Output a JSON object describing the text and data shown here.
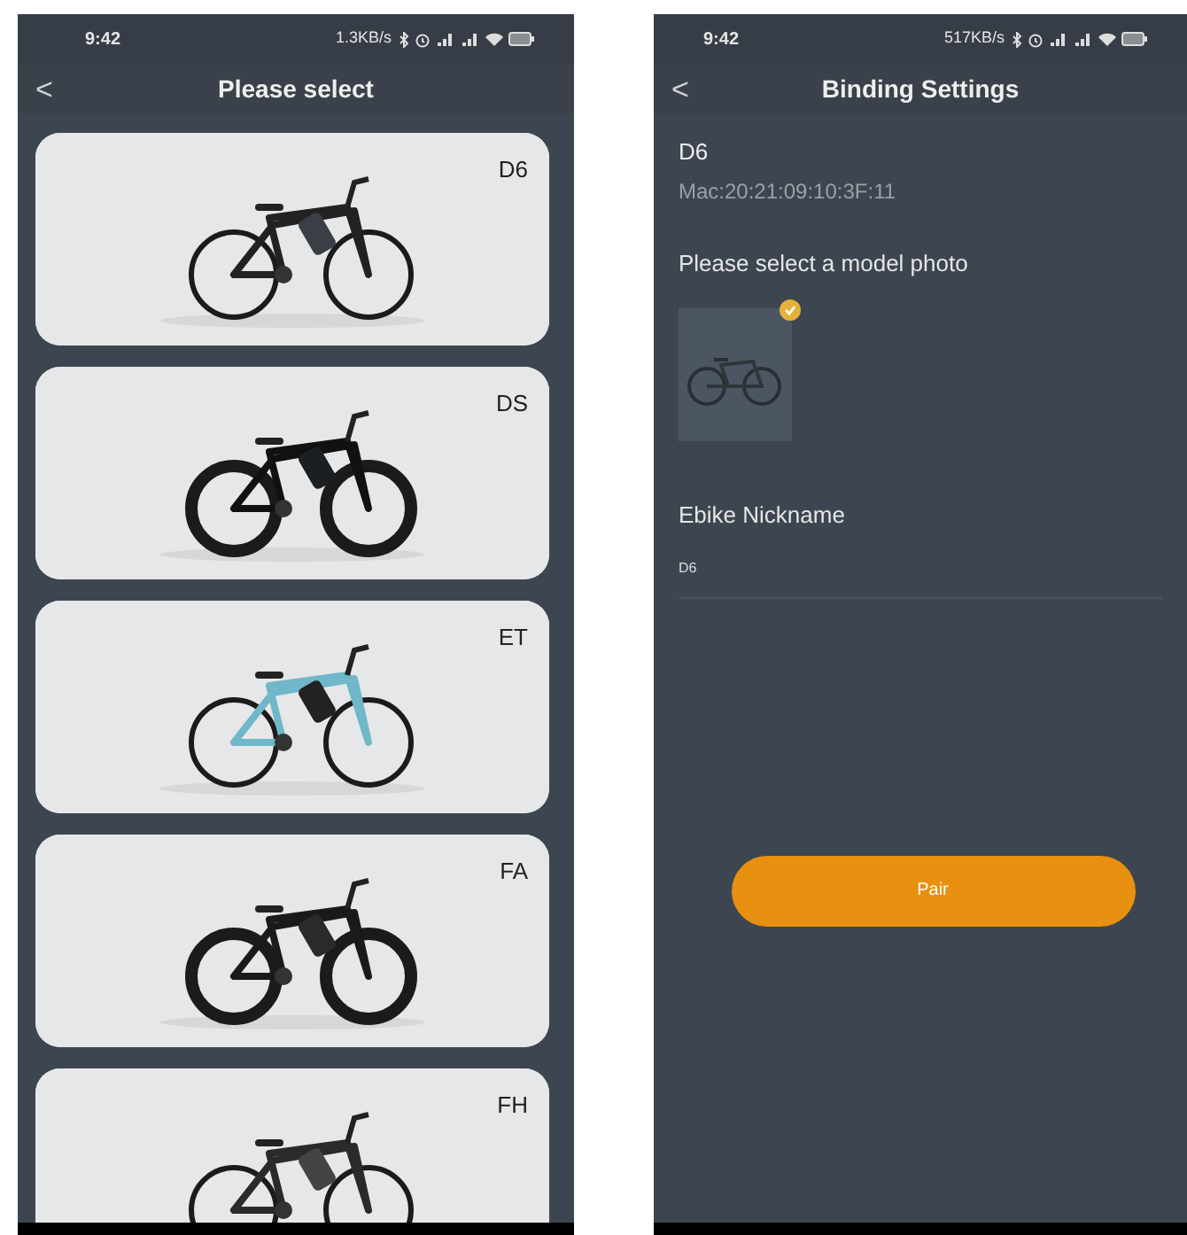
{
  "model_screen": {
    "status_bar": {
      "time": "9:42",
      "speed": "1.3KB/s"
    },
    "title": "Please select",
    "back": "<",
    "models": [
      {
        "name": "D6"
      },
      {
        "name": "DS"
      },
      {
        "name": "ET"
      },
      {
        "name": "FA"
      },
      {
        "name": "FH"
      }
    ]
  },
  "binding_screen": {
    "status_bar": {
      "time": "9:42",
      "speed": "517KB/s"
    },
    "title": "Binding Settings",
    "back": "<",
    "device_name": "D6",
    "mac": "Mac:20:21:09:10:3F:11",
    "photo_prompt": "Please select a model photo",
    "photos": [
      {
        "selected": true
      }
    ],
    "nickname_label": "Ebike Nickname",
    "nickname_value": "D6",
    "button": "Pair"
  }
}
